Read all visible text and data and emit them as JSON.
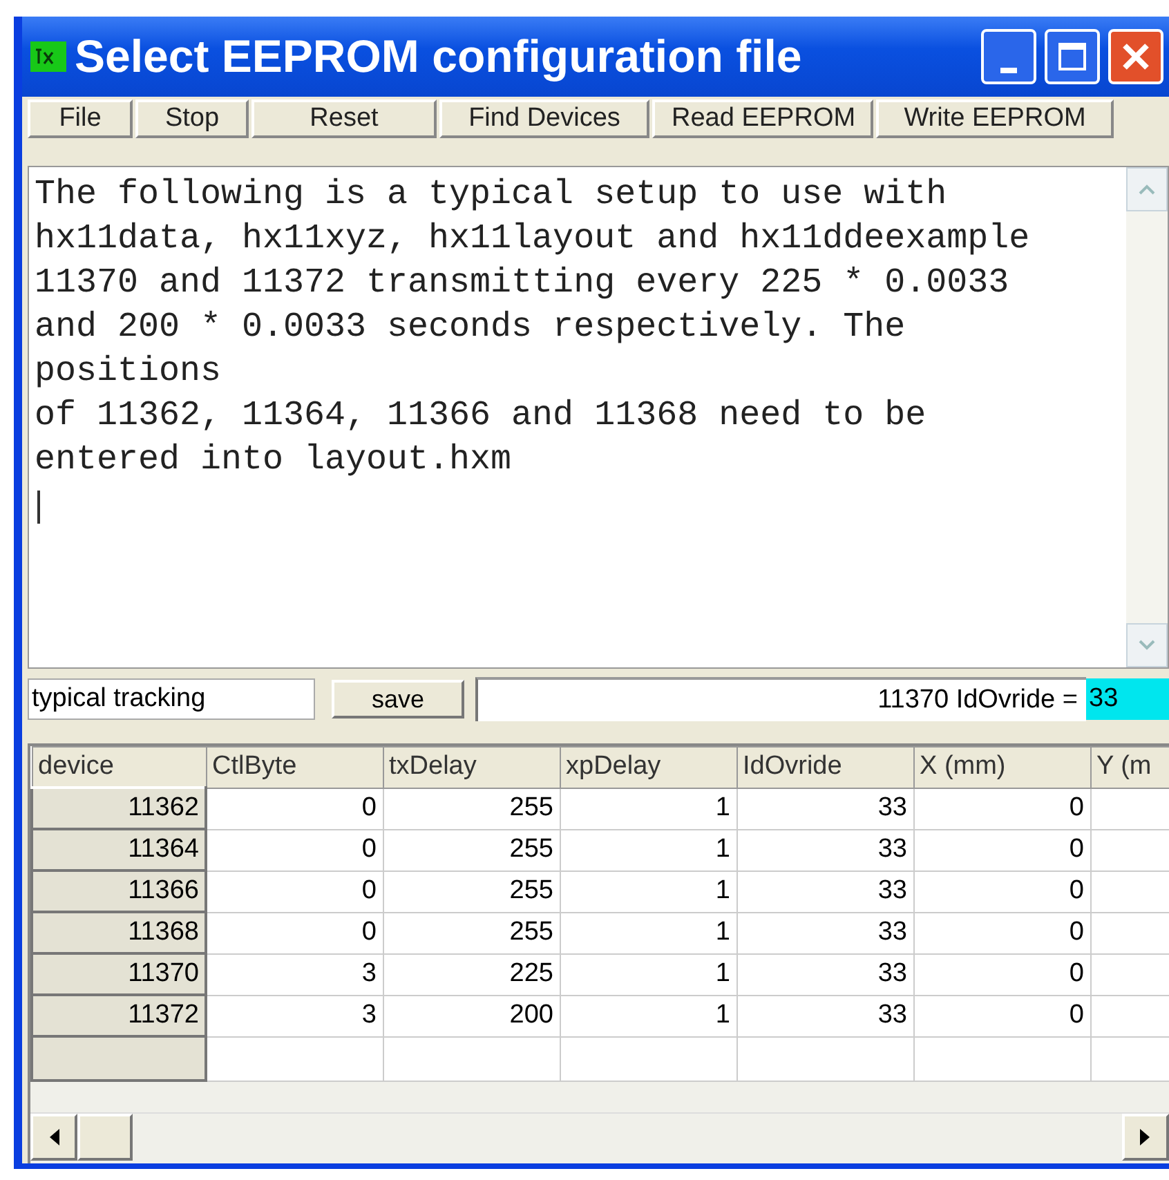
{
  "window": {
    "title": "Select EEPROM configuration file"
  },
  "toolbar": [
    "File",
    "Stop",
    "Reset",
    "Find Devices",
    "Read EEPROM",
    "Write EEPROM"
  ],
  "memo": {
    "lines": [
      "The following is a typical setup to use with",
      "hx11data, hx11xyz, hx11layout and hx11ddeexample",
      "11370 and 11372 transmitting every 225 * 0.0033",
      "and 200 * 0.0033 seconds respectively. The",
      "positions",
      "of 11362, 11364, 11366 and 11368 need to be",
      "entered into layout.hxm"
    ]
  },
  "setup": {
    "name_value": "typical tracking",
    "save_button": "save",
    "status": "11370 IdOvride =",
    "value": "33"
  },
  "table": {
    "columns": [
      "device",
      "CtlByte",
      "txDelay",
      "xpDelay",
      "IdOvride",
      "X (mm)",
      "Y (m"
    ],
    "rows": [
      {
        "cells": [
          "11362",
          "0",
          "255",
          "1",
          "33",
          "0"
        ]
      },
      {
        "cells": [
          "11364",
          "0",
          "255",
          "1",
          "33",
          "0"
        ]
      },
      {
        "cells": [
          "11366",
          "0",
          "255",
          "1",
          "33",
          "0"
        ]
      },
      {
        "cells": [
          "11368",
          "0",
          "255",
          "1",
          "33",
          "0"
        ]
      },
      {
        "cells": [
          "11370",
          "3",
          "225",
          "1",
          "33",
          "0"
        ]
      },
      {
        "cells": [
          "11372",
          "3",
          "200",
          "1",
          "33",
          "0"
        ]
      }
    ]
  }
}
